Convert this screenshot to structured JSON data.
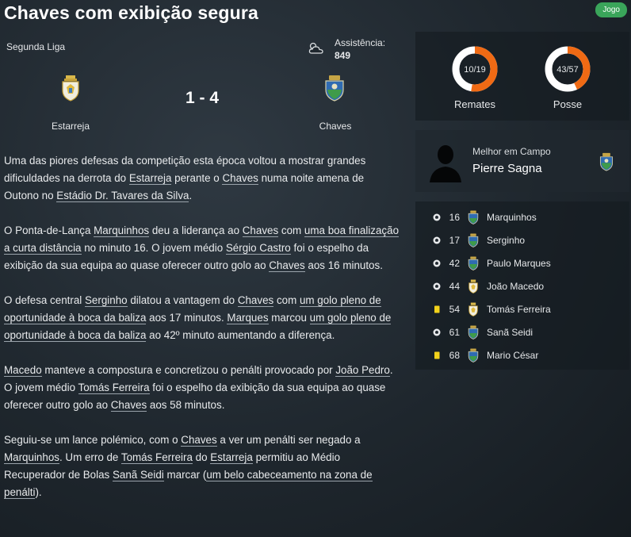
{
  "header": {
    "title": "Chaves com exibição segura",
    "badge": "Jogo"
  },
  "match": {
    "league": "Segunda Liga",
    "attendance_label": "Assistência:",
    "attendance_value": "849",
    "home_team": "Estarreja",
    "away_team": "Chaves",
    "score": "1 - 4",
    "weather_icon": "cloudy-weather-icon"
  },
  "stats": {
    "shots": {
      "label": "Remates",
      "value_text": "10/19",
      "fraction": 0.526
    },
    "possession": {
      "label": "Posse",
      "value_text": "43/57",
      "fraction": 0.43
    },
    "accent": "#f06a14",
    "track": "#ffffff"
  },
  "motm": {
    "label": "Melhor em Campo",
    "name": "Pierre Sagna",
    "icon": "player-silhouette-icon"
  },
  "events": [
    {
      "type": "goal",
      "minute": "16",
      "team": "away",
      "player": "Marquinhos"
    },
    {
      "type": "goal",
      "minute": "17",
      "team": "away",
      "player": "Serginho"
    },
    {
      "type": "goal",
      "minute": "42",
      "team": "away",
      "player": "Paulo Marques"
    },
    {
      "type": "goal",
      "minute": "44",
      "team": "home",
      "player": "João Macedo"
    },
    {
      "type": "yellow-card",
      "minute": "54",
      "team": "home",
      "player": "Tomás Ferreira"
    },
    {
      "type": "goal",
      "minute": "61",
      "team": "away",
      "player": "Sanã Seidi"
    },
    {
      "type": "yellow-card",
      "minute": "68",
      "team": "away",
      "player": "Mario César"
    }
  ],
  "story": {
    "p1": {
      "t1": "Uma das piores defesas da competição esta época voltou a mostrar grandes dificuldades na derrota do ",
      "l1": "Estarreja",
      "t2": " perante o ",
      "l2": "Chaves",
      "t3": " numa noite amena de Outono no ",
      "l3": "Estádio Dr. Tavares da Silva",
      "t4": "."
    },
    "p2": {
      "t1": "O Ponta-de-Lança ",
      "l1": "Marquinhos",
      "t2": " deu a liderança ao ",
      "l2": "Chaves",
      "t3": " com ",
      "l3": "uma boa finalização a curta distância",
      "t4": " no minuto 16. O jovem médio ",
      "l4": "Sérgio Castro",
      "t5": " foi o espelho da exibição da sua equipa ao quase oferecer outro golo ao ",
      "l5": "Chaves",
      "t6": " aos 16 minutos."
    },
    "p3": {
      "t1": "O defesa central ",
      "l1": "Serginho",
      "t2": " dilatou a vantagem do ",
      "l2": "Chaves",
      "t3": " com ",
      "l3": "um golo pleno de oportunidade à boca da baliza",
      "t4": " aos 17 minutos. ",
      "l4": "Marques",
      "t5": " marcou ",
      "l5": "um golo pleno de oportunidade à boca da baliza",
      "t6": " ao 42º minuto aumentando a diferença."
    },
    "p4": {
      "l1": "Macedo",
      "t1": " manteve a compostura e concretizou o penálti provocado por ",
      "l2": "João Pedro",
      "t2": ". O jovem médio ",
      "l3": "Tomás Ferreira",
      "t3": " foi o espelho da exibição da sua equipa ao quase oferecer outro golo ao ",
      "l4": "Chaves",
      "t4": " aos 58 minutos."
    },
    "p5": {
      "t1": "Seguiu-se um lance polémico, com o ",
      "l1": "Chaves",
      "t2": " a ver um penálti ser negado a ",
      "l2": "Marquinhos",
      "t3": ". Um erro de ",
      "l3": "Tomás Ferreira",
      "t4": " do ",
      "l4": "Estarreja",
      "t5": " permitiu ao Médio Recuperador de Bolas ",
      "l5": "Sanã Seidi",
      "t6": " marcar (",
      "l6": "um belo cabeceamento na zona de penálti",
      "t7": ")."
    }
  }
}
